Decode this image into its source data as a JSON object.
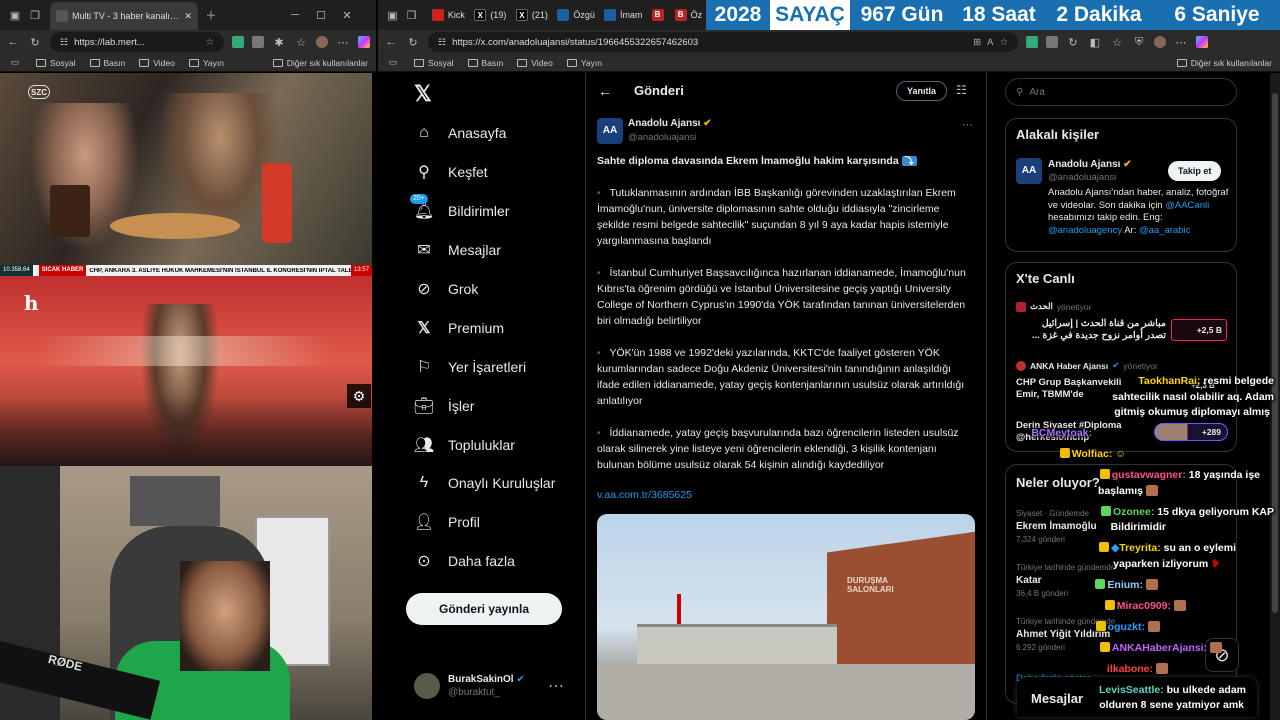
{
  "left_browser": {
    "tab_title": "Multi TV - 3 haber kanalını aynı a",
    "url": "https://lab.mert...",
    "bookmarks": [
      "Sosyal",
      "Basın",
      "Video",
      "Yayın"
    ],
    "other_bookmarks": "Diğer sık kullanılanlar"
  },
  "streams": {
    "szc_logo": "SZC",
    "ticker_views": "10.358.64",
    "ticker_tag": "SICAK HABER",
    "ticker_text": "CHP, ANKARA 3. ASLİYE HUKUK MAHKEMESİ'NİN İSTANBUL İL KONGRESİ'NİN İPTAL TALEBİ",
    "ticker_time": "13:57",
    "halk_logo": "h",
    "mic_brand": "RØDE"
  },
  "right_browser": {
    "tabs": [
      "Kick",
      "(19)",
      "(21)",
      "Özgü",
      "İmam",
      "B",
      "Öz"
    ],
    "url": "https://x.com/anadoluajansi/status/1966455322657462603",
    "bookmarks": [
      "Sosyal",
      "Basın",
      "Video",
      "Yayın"
    ],
    "other_bookmarks": "Diğer sık kullanılanlar"
  },
  "counter": {
    "year": "2028",
    "label": "SAYAÇ",
    "days": "967 Gün",
    "hours": "18 Saat",
    "minutes": "2 Dakika",
    "seconds": "6 Saniye"
  },
  "nav": {
    "items": [
      "Anasayfa",
      "Keşfet",
      "Bildirimler",
      "Mesajlar",
      "Grok",
      "Premium",
      "Yer İşaretleri",
      "İşler",
      "Topluluklar",
      "Onaylı Kuruluşlar",
      "Profil",
      "Daha fazla"
    ],
    "notif_badge": "20+",
    "post_button": "Gönderi yayınla",
    "user_name": "BurakSakinOl",
    "user_handle": "@buraktut_"
  },
  "main": {
    "header_title": "Gönderi",
    "reply_button": "Yanıtla",
    "author_name": "Anadolu Ajansı",
    "author_handle": "@anadoluajansi",
    "headline": "Sahte diploma davasında Ekrem İmamoğlu hakim karşısında",
    "paragraphs": [
      "Tutuklanmasının ardından İBB Başkanlığı görevinden uzaklaştırılan Ekrem İmamoğlu'nun, üniversite diplomasının sahte olduğu iddiasıyla \"zincirleme şekilde resmi belgede sahtecilik\" suçundan 8 yıl 9 aya kadar hapis istemiyle yargılanmasına başlandı",
      "İstanbul Cumhuriyet Başsavcılığınca hazırlanan iddianamede, İmamoğlu'nun Kıbrıs'ta öğrenim gördüğü ve İstanbul Üniversitesine geçiş yaptığı University College of Northern Cyprus'ın 1990'da YÖK tarafından tanınan üniversitelerden biri olmadığı belirtiliyor",
      "YÖK'ün 1988 ve 1992'deki yazılarında, KKTC'de faaliyet gösteren YÖK kurumlarından sadece Doğu Akdeniz Üniversitesi'nin tanındığının anlaşıldığı ifade edilen iddianamede, yatay geçiş kontenjanlarının usulsüz olarak artırıldığı anlatılıyor",
      "İddianamede, yatay geçiş başvurularında bazı öğrencilerin listeden usulsüz olarak silinerek yine listeye yeni öğrencilerin eklendiği, 3 kişilik kontenjanı bulunan bölüme usulsüz olarak 54 kişinin alındığı kaydediliyor"
    ],
    "link": "v.aa.com.tr/3685625",
    "image_sign": "DURUŞMA SALONLARI"
  },
  "right": {
    "search_placeholder": "Ara",
    "related_title": "Alakalı kişiler",
    "rel_name": "Anadolu Ajansı",
    "rel_handle": "@anadoluajansi",
    "follow_button": "Takip et",
    "rel_bio_1": "Anadolu Ajansı'ndan haber, analiz, fotoğraf ve videolar. Son dakika için",
    "rel_bio_link1": "@AACanli",
    "rel_bio_2": "hesabımızı takip edin. Eng:",
    "rel_bio_link2": "@anadoluagency",
    "rel_bio_3": "Ar:",
    "rel_bio_link3": "@aa_arabic",
    "live_title": "X'te Canlı",
    "live1_host": "الحدث",
    "live1_role": "yönetiyor",
    "live1_text_1": "مباشر من قناة الحدث | إسرائيل",
    "live1_text_2": "تصدر أوامر نزوح جديدة في غزة ...",
    "live1_count": "+2,5 B",
    "live2_host": "ANKA Haber Ajansı",
    "live2_role": "yönetiyor",
    "live2_text_1": "CHP Grup Başkanvekili",
    "live2_text_2": "Emir, TBMM'de",
    "live2_count": "+2,3 B",
    "live3_text_1": "Derin Siyaset #Diploma",
    "live3_text_2": "@herkesicinchp",
    "live3_count": "+289",
    "trends_title": "Neler oluyor?",
    "trends": [
      {
        "context": "Siyaset · Gündemde",
        "name": "Ekrem İmamoğlu",
        "count": "7.324 gönderi"
      },
      {
        "context": "Türkiye tarihinde gündemde",
        "name": "Katar",
        "count": "36,4 B gönderi"
      },
      {
        "context": "Türkiye tarihinde gündemde",
        "name": "Ahmet Yiğit Yıldırım",
        "count": "6.292 gönderi"
      }
    ],
    "show_more": "Daha fazla göster",
    "messages_label": "Mesajlar"
  },
  "chat": [
    {
      "user": "TaokhanRai:",
      "color": "#ffd400",
      "text": "resmi belgede"
    },
    {
      "user": "",
      "color": "#ffffff",
      "text": "sahtecilik nasıl olabilir aq. Adam"
    },
    {
      "user": "",
      "color": "#ffffff",
      "text": "gitmiş okumuş diplomayı almış"
    },
    {
      "user": "BCMeytoak:",
      "color": "#a970ff",
      "text": ""
    },
    {
      "user": "Wolfiac:",
      "color": "#ffd400",
      "text": ""
    },
    {
      "user": "gustavwagner:",
      "color": "#ff4f8b",
      "text": "18 yaşında işe"
    },
    {
      "user": "",
      "color": "#ffffff",
      "text": "başlamış"
    },
    {
      "user": "Ozonee:",
      "color": "#5cd65c",
      "text": "15 dkya geliyorum KAP"
    },
    {
      "user": "",
      "color": "#ffffff",
      "text": "Bildirimidir"
    },
    {
      "user": "Treyrita:",
      "color": "#ffd400",
      "text": "su an o eylemi"
    },
    {
      "user": "",
      "color": "#ffffff",
      "text": "yaparken izliyorum"
    },
    {
      "user": "Enium:",
      "color": "#8fd0ff",
      "text": ""
    },
    {
      "user": "Mirac0909:",
      "color": "#ff4f8b",
      "text": ""
    },
    {
      "user": "oguzkt:",
      "color": "#2e9bff",
      "text": ""
    },
    {
      "user": "ANKAHaberAjansi:",
      "color": "#c060ff",
      "text": ""
    },
    {
      "user": "ilkabone:",
      "color": "#ff4040",
      "text": ""
    },
    {
      "user": "LevisSeattle:",
      "color": "#5cd6c0",
      "text": "bu ulkede adam"
    },
    {
      "user": "",
      "color": "#ffffff",
      "text": "olduren 8 sene yatmiyor amk"
    }
  ]
}
